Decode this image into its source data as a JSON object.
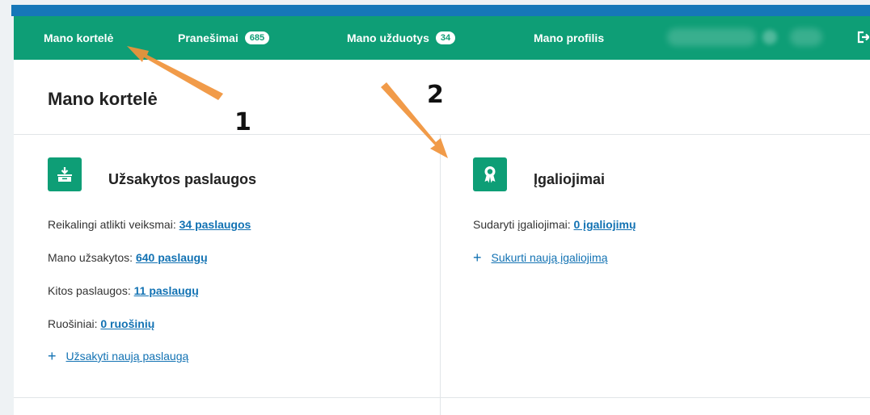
{
  "nav": {
    "items": [
      {
        "label": "Mano kortelė"
      },
      {
        "label": "Pranešimai",
        "badge": "685"
      },
      {
        "label": "Mano užduotys",
        "badge": "34"
      },
      {
        "label": "Mano profilis"
      }
    ],
    "logout_icon": "logout-icon"
  },
  "page": {
    "title": "Mano kortelė"
  },
  "cards": {
    "services": {
      "icon": "inbox-download-icon",
      "title": "Užsakytos paslaugos",
      "rows": [
        {
          "label": "Reikalingi atlikti veiksmai:",
          "link": "34 paslaugos"
        },
        {
          "label": "Mano užsakytos:",
          "link": "640 paslaugų"
        },
        {
          "label": "Kitos paslaugos:",
          "link": "11 paslaugų"
        },
        {
          "label": "Ruošiniai:",
          "link": "0 ruošinių"
        }
      ],
      "add_label": "Užsakyti naują paslaugą"
    },
    "authorizations": {
      "icon": "award-ribbon-icon",
      "title": "Įgaliojimai",
      "rows": [
        {
          "label": "Sudaryti įgaliojimai:",
          "link": "0 įgaliojimų"
        }
      ],
      "add_label": "Sukurti naują įgaliojimą"
    }
  },
  "annotations": {
    "marker_1": "1",
    "marker_2": "2",
    "arrow_color": "#f0933a"
  },
  "colors": {
    "accent_green": "#0e9e76",
    "top_blue": "#1677b8",
    "link_blue": "#1272b3"
  }
}
